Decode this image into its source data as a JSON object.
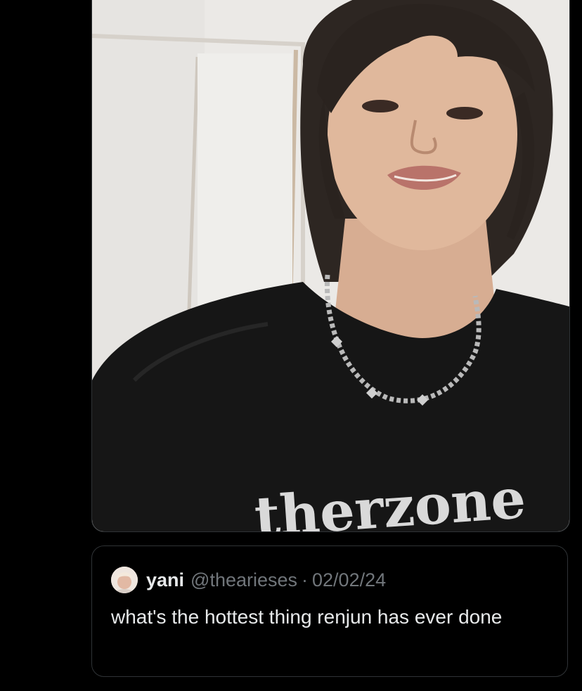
{
  "media": {
    "photo_alt_icon": "portrait-photo-icon",
    "shirt_print": "therzone"
  },
  "quoted_post": {
    "avatar_icon": "avatar-icon",
    "display_name": "yani",
    "handle": "@thearieses",
    "separator": "·",
    "date": "02/02/24",
    "text": "what's the hottest thing renjun has ever done"
  },
  "colors": {
    "background": "#000000",
    "card_border": "#2f3336",
    "primary_text": "#e7e9ea",
    "secondary_text": "#71767b"
  }
}
